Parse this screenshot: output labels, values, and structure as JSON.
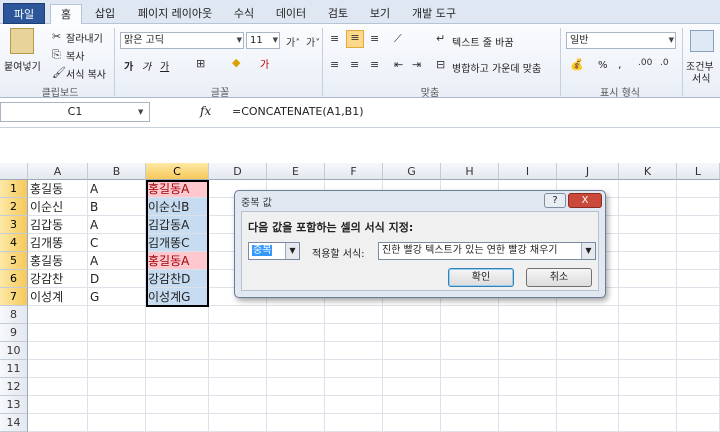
{
  "tabs": [
    "파일",
    "홈",
    "삽입",
    "페이지 레이아웃",
    "수식",
    "데이터",
    "검토",
    "보기",
    "개발 도구"
  ],
  "ribbon": {
    "paste": "붙여넣기",
    "cut": "잘라내기",
    "copy": "복사",
    "format_painter": "서식 복사",
    "clipboard_label": "클립보드",
    "font_name": "맑은 고딕",
    "font_size": "11",
    "font_label": "글꼴",
    "bold": "가",
    "italic": "가",
    "underline": "가",
    "wrap_text": "텍스트 줄 바꿈",
    "merge_center": "병합하고 가운데 맞춤",
    "align_label": "맞춤",
    "number_format": "일반",
    "number_label": "표시 형식",
    "conditional": "조건부",
    "conditional2": "서식",
    "percent": "%"
  },
  "formula_bar": {
    "name_box": "C1",
    "fx": "fx",
    "formula": "=CONCATENATE(A1,B1)"
  },
  "columns": [
    "A",
    "B",
    "C",
    "D",
    "E",
    "F",
    "G",
    "H",
    "I",
    "J",
    "K",
    "L"
  ],
  "rows": [
    "1",
    "2",
    "3",
    "4",
    "5",
    "6",
    "7",
    "8",
    "9",
    "10",
    "11",
    "12",
    "13",
    "14"
  ],
  "cells": {
    "A": [
      "홍길동",
      "이순신",
      "김갑동",
      "김개똥",
      "홍길동",
      "강감찬",
      "이성계"
    ],
    "B": [
      "A",
      "B",
      "A",
      "C",
      "A",
      "D",
      "G"
    ],
    "C": [
      "홍길동A",
      "이순신B",
      "김갑동A",
      "김개똥C",
      "홍길동A",
      "강감찬D",
      "이성계G"
    ]
  },
  "duplicate_rows": [
    0,
    4
  ],
  "dialog": {
    "title": "중복 값",
    "help": "?",
    "close": "X",
    "instruction": "다음 값을 포함하는 셀의 서식 지정:",
    "type_value": "중복",
    "apply_label": "적용할 서식:",
    "format_value": "진한 빨강 텍스트가 있는 연한 빨강 채우기",
    "ok": "확인",
    "cancel": "취소"
  }
}
